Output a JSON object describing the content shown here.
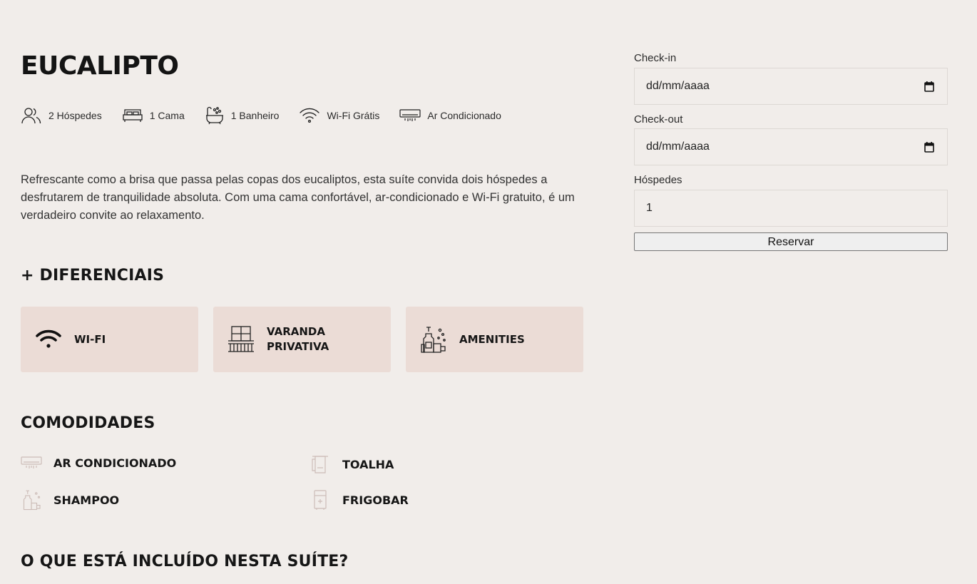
{
  "room": {
    "title": "EUCALIPTO",
    "features": [
      {
        "icon": "guests-icon",
        "label": "2 Hóspedes"
      },
      {
        "icon": "bed-icon",
        "label": "1 Cama"
      },
      {
        "icon": "bathtub-icon",
        "label": "1 Banheiro"
      },
      {
        "icon": "wifi-icon",
        "label": "Wi-Fi Grátis"
      },
      {
        "icon": "air-conditioner-icon",
        "label": "Ar Condicionado"
      }
    ],
    "description": "Refrescante como a brisa que passa pelas copas dos eucaliptos, esta suíte convida dois hóspedes a desfrutarem de tranquilidade absoluta. Com uma cama confortável, ar-condicionado e Wi-Fi gratuito, é um verdadeiro convite ao relaxamento."
  },
  "differentials": {
    "title": "+ DIFERENCIAIS",
    "items": [
      {
        "icon": "wifi-icon",
        "label": "WI-FI"
      },
      {
        "icon": "balcony-icon",
        "label": "VARANDA\nPRIVATIVA"
      },
      {
        "icon": "toiletries-icon",
        "label": "AMENITIES"
      }
    ]
  },
  "amenities": {
    "title": "COMODIDADES",
    "items": [
      {
        "icon": "air-conditioner-icon",
        "label": "AR CONDICIONADO"
      },
      {
        "icon": "towel-icon",
        "label": "TOALHA"
      },
      {
        "icon": "shampoo-icon",
        "label": "SHAMPOO"
      },
      {
        "icon": "minibar-icon",
        "label": "FRIGOBAR"
      }
    ]
  },
  "included": {
    "title": "O QUE ESTÁ INCLUÍDO NESTA SUÍTE?"
  },
  "booking": {
    "checkin_label": "Check-in",
    "checkin_placeholder": "dd/mm/aaaa",
    "checkout_label": "Check-out",
    "checkout_placeholder": "dd/mm/aaaa",
    "guests_label": "Hóspedes",
    "guests_value": "1",
    "submit_label": "Reservar"
  },
  "colors": {
    "background": "#f1edea",
    "card_background": "#ebdcd6",
    "muted_icon": "#cdbdb8"
  }
}
